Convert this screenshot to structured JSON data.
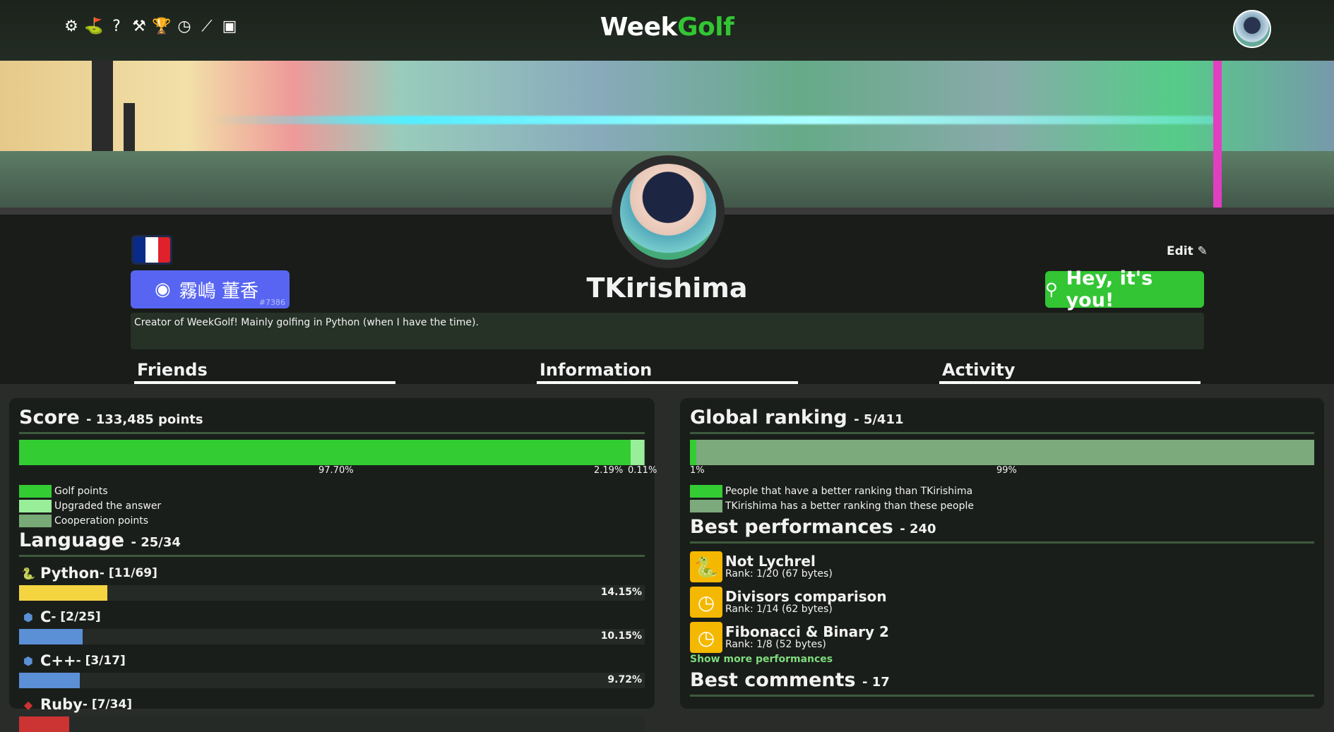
{
  "app": {
    "logo_a": "Week",
    "logo_b": "Golf"
  },
  "toolbar_icons": [
    "gear-icon",
    "hole-flag-icon",
    "help-icon",
    "tools-icon",
    "trophy-icon",
    "clock-icon",
    "chart-line-icon",
    "pay-icon"
  ],
  "profile": {
    "discord_name": "霧嶋 董香",
    "discord_tag": "#7386",
    "username": "TKirishima",
    "edit_label": "Edit",
    "hey_label": "Hey, it's you!",
    "bio": "Creator of WeekGolf! Mainly golfing in Python (when I have the time)."
  },
  "tabs": [
    "Friends",
    "Information",
    "Activity"
  ],
  "score": {
    "title": "Score",
    "subtitle": "- 133,485 points",
    "segments": [
      {
        "pct": 97.7,
        "label": "97.70%",
        "color": "#33cc33"
      },
      {
        "pct": 2.19,
        "label": "2.19%",
        "color": "#99ee99"
      },
      {
        "pct": 0.11,
        "label": "0.11%",
        "color": "#77aa77"
      }
    ],
    "legend": [
      "Golf points",
      "Upgraded the answer",
      "Cooperation points"
    ]
  },
  "language": {
    "title": "Language",
    "subtitle": "- 25/34",
    "items": [
      {
        "name": "Python",
        "rank": " - [11/69]",
        "pct": 14.15,
        "label": "14.15%",
        "color": "#f5d442",
        "icon": "python-icon"
      },
      {
        "name": "C",
        "rank": " - [2/25]",
        "pct": 10.15,
        "label": "10.15%",
        "color": "#5b8fd6",
        "icon": "c-language-icon"
      },
      {
        "name": "C++",
        "rank": " - [3/17]",
        "pct": 9.72,
        "label": "9.72%",
        "color": "#5b8fd6",
        "icon": "cpp-language-icon"
      },
      {
        "name": "Ruby",
        "rank": " - [7/34]",
        "pct": 8.0,
        "label": "",
        "color": "#cc3333",
        "icon": "ruby-icon"
      }
    ]
  },
  "ranking": {
    "title": "Global ranking",
    "subtitle": "- 5/411",
    "segments": [
      {
        "pct": 1,
        "label": "1%",
        "color": "#33cc33"
      },
      {
        "pct": 99,
        "label": "99%",
        "color": "#7caa7c"
      }
    ],
    "legend": [
      "People that have a better ranking than TKirishima",
      "TKirishima has a better ranking than these people"
    ]
  },
  "performances": {
    "title": "Best performances",
    "subtitle": "- 240",
    "items": [
      {
        "title": "Not Lychrel",
        "rank": "Rank: 1/20 (67 bytes)",
        "icon": "python-icon"
      },
      {
        "title": "Divisors comparison",
        "rank": "Rank: 1/14 (62 bytes)",
        "icon": "clock-icon"
      },
      {
        "title": "Fibonacci & Binary 2",
        "rank": "Rank: 1/8 (52 bytes)",
        "icon": "clock-icon"
      }
    ],
    "more_label": "Show more performances"
  },
  "comments": {
    "title": "Best comments",
    "subtitle": "- 17"
  }
}
